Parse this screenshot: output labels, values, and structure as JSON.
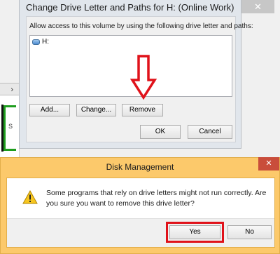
{
  "background": {
    "scroll_arrow": "›",
    "disk_letter_partial": "S"
  },
  "change_dialog": {
    "title": "Change Drive Letter and Paths for H: (Online Work)",
    "instruction": "Allow access to this volume by using the following drive letter and paths:",
    "drives": [
      {
        "label": "H:"
      }
    ],
    "add_button": "Add...",
    "change_button": "Change...",
    "remove_button": "Remove",
    "ok_button": "OK",
    "cancel_button": "Cancel",
    "close_glyph": "✕"
  },
  "confirm_dialog": {
    "title": "Disk Management",
    "message": "Some programs that rely on drive letters might not run correctly. Are you sure you want to remove this drive letter?",
    "yes_button": "Yes",
    "no_button": "No",
    "close_glyph": "✕"
  },
  "colors": {
    "annotation_red": "#e0121a",
    "dialog_accent": "#fcc96b"
  }
}
